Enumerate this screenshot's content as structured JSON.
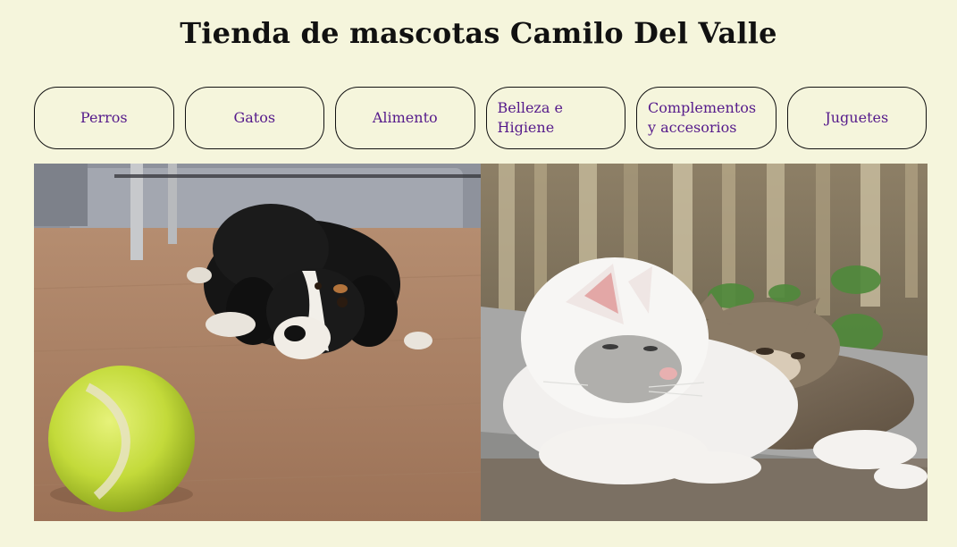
{
  "page": {
    "title": "Tienda de mascotas Camilo Del Valle"
  },
  "nav": {
    "items": [
      {
        "label": "Perros"
      },
      {
        "label": "Gatos"
      },
      {
        "label": "Alimento"
      },
      {
        "label": "Belleza e Higiene"
      },
      {
        "label": "Complementos y accesorios"
      },
      {
        "label": "Juguetes"
      }
    ]
  },
  "colors": {
    "background": "#f5f5dc",
    "link": "#551a8b",
    "border": "#111111"
  }
}
